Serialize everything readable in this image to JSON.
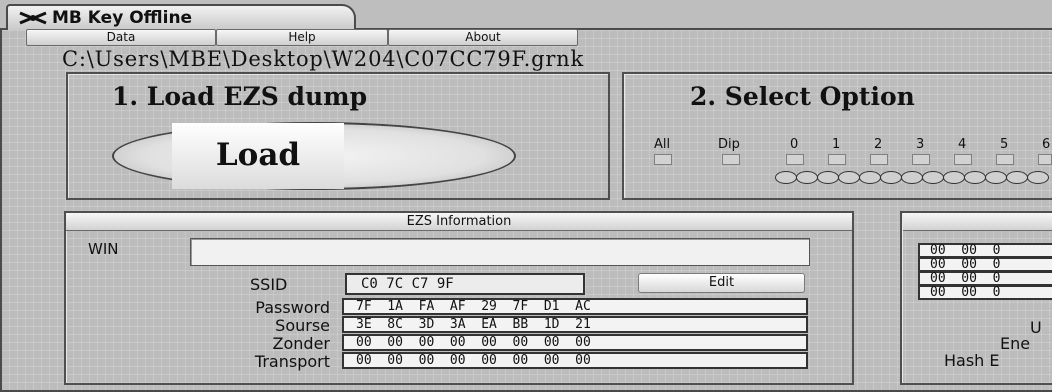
{
  "window": {
    "title": "MB Key Offline"
  },
  "menu": {
    "items": [
      "Data",
      "Help",
      "About"
    ]
  },
  "file_path": "C:\\Users\\MBE\\Desktop\\W204\\C07CC79F.grnk",
  "load_section": {
    "title": "1. Load EZS dump",
    "load_button": "Load"
  },
  "options_section": {
    "title": "2. Select Option",
    "labels": [
      "All",
      "Dip",
      "0",
      "1",
      "2",
      "3",
      "4",
      "5",
      "6"
    ]
  },
  "ezs_info": {
    "header": "EZS Information",
    "win_label": "WIN",
    "win_value": "",
    "ssid_label": "SSID",
    "ssid_value": "C0  7C  C7  9F",
    "edit_button": "Edit",
    "rows": [
      {
        "label": "Password",
        "value": "7F  1A  FA  AF  29  7F  D1  AC"
      },
      {
        "label": "Sourse",
        "value": "3E  8C  3D  3A  EA  BB  1D  21"
      },
      {
        "label": "Zonder",
        "value": "00  00  00  00  00  00  00  00"
      },
      {
        "label": "Transport",
        "value": "00  00  00  00  00  00  00  00"
      }
    ]
  },
  "right_panel": {
    "rows": [
      "00  00  0",
      "00  00  0",
      "00  00  0",
      "00  00  0"
    ],
    "labels": [
      "U",
      "Ene",
      "Hash E"
    ]
  }
}
